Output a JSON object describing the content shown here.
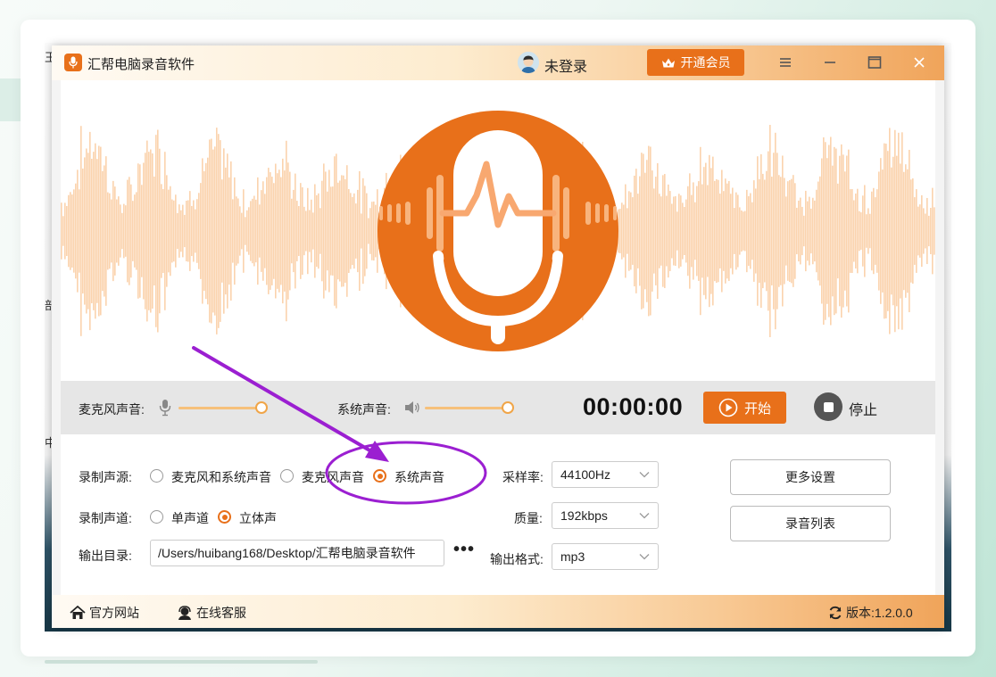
{
  "app": {
    "title": "汇帮电脑录音软件",
    "login_text": "未登录",
    "vip_label": "开通会员"
  },
  "colors": {
    "accent": "#e8701a",
    "wave": "#fbd3ad",
    "annotation": "#9b1fd1"
  },
  "icons": {
    "app_logo": "microphone-icon",
    "vip": "crown-icon",
    "menu": "menu-icon",
    "minimize": "minimize-icon",
    "maximize": "maximize-icon",
    "close": "close-icon"
  },
  "controls": {
    "mic_label": "麦克风声音:",
    "mic_level": 1.0,
    "sys_label": "系统声音:",
    "sys_level": 1.0,
    "timer": "00:00:00",
    "start_label": "开始",
    "stop_label": "停止"
  },
  "settings": {
    "source_label": "录制声源:",
    "source_options": [
      {
        "label": "麦克风和系统声音",
        "selected": false
      },
      {
        "label": "麦克风声音",
        "selected": false
      },
      {
        "label": "系统声音",
        "selected": true
      }
    ],
    "channel_label": "录制声道:",
    "channel_options": [
      {
        "label": "单声道",
        "selected": false
      },
      {
        "label": "立体声",
        "selected": true
      }
    ],
    "output_label": "输出目录:",
    "output_path": "/Users/huibang168/Desktop/汇帮电脑录音软件",
    "more_label": "•••",
    "sample_rate_label": "采样率:",
    "sample_rate_value": "44100Hz",
    "quality_label": "质量:",
    "quality_value": "192kbps",
    "format_label": "输出格式:",
    "format_value": "mp3",
    "more_settings_label": "更多设置",
    "record_list_label": "录音列表"
  },
  "footer": {
    "website_label": "官方网站",
    "service_label": "在线客服",
    "version_label": "版本:1.2.0.0"
  }
}
